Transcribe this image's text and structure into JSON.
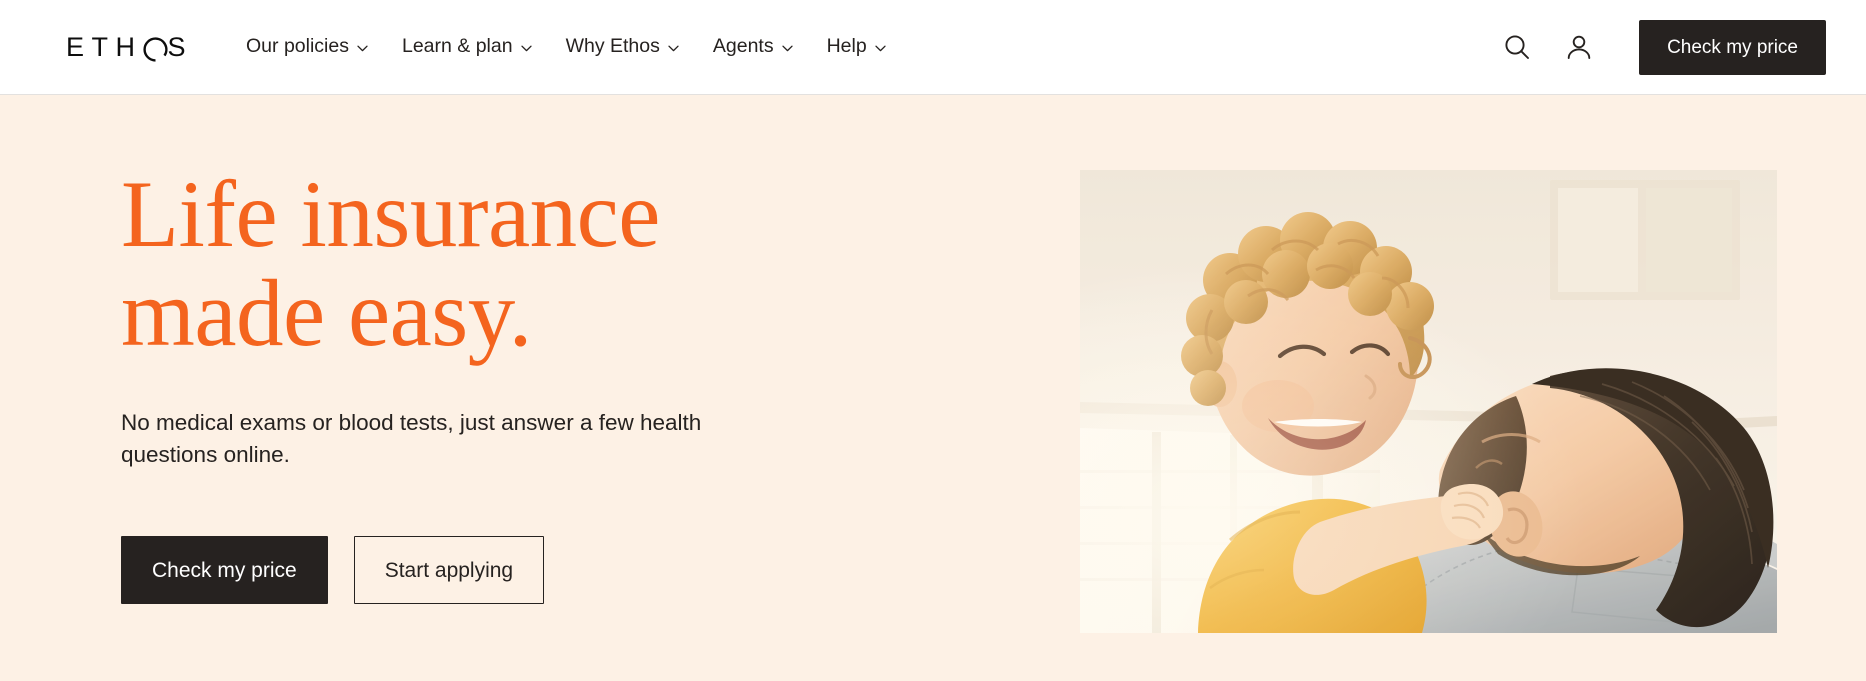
{
  "header": {
    "logo": {
      "text_before": "ETH",
      "o_glyph": "O",
      "text_after": "S",
      "full": "ETHOS",
      "icon": "ethos-wordmark"
    },
    "nav": [
      {
        "label": "Our policies",
        "has_dropdown": true,
        "icon": "chevron-down-icon"
      },
      {
        "label": "Learn & plan",
        "has_dropdown": true,
        "icon": "chevron-down-icon"
      },
      {
        "label": "Why Ethos",
        "has_dropdown": true,
        "icon": "chevron-down-icon"
      },
      {
        "label": "Agents",
        "has_dropdown": true,
        "icon": "chevron-down-icon"
      },
      {
        "label": "Help",
        "has_dropdown": true,
        "icon": "chevron-down-icon"
      }
    ],
    "search_icon": "search-icon",
    "account_icon": "user-account-icon",
    "cta_label": "Check my price"
  },
  "hero": {
    "title_line1": "Life insurance",
    "title_line2": "made easy.",
    "subtitle": "No medical exams or blood tests, just answer a few health questions online.",
    "primary_cta": "Check my price",
    "secondary_cta": "Start applying",
    "image_alt": "Smiling toddler in a yellow shirt touching the face of a bearded man in a denim shirt"
  },
  "colors": {
    "brand_orange": "#f4641e",
    "hero_background": "#fdf1e5",
    "dark": "#262220",
    "header_background": "#ffffff",
    "header_border": "#e3e1df",
    "button_text": "#ffffff"
  }
}
